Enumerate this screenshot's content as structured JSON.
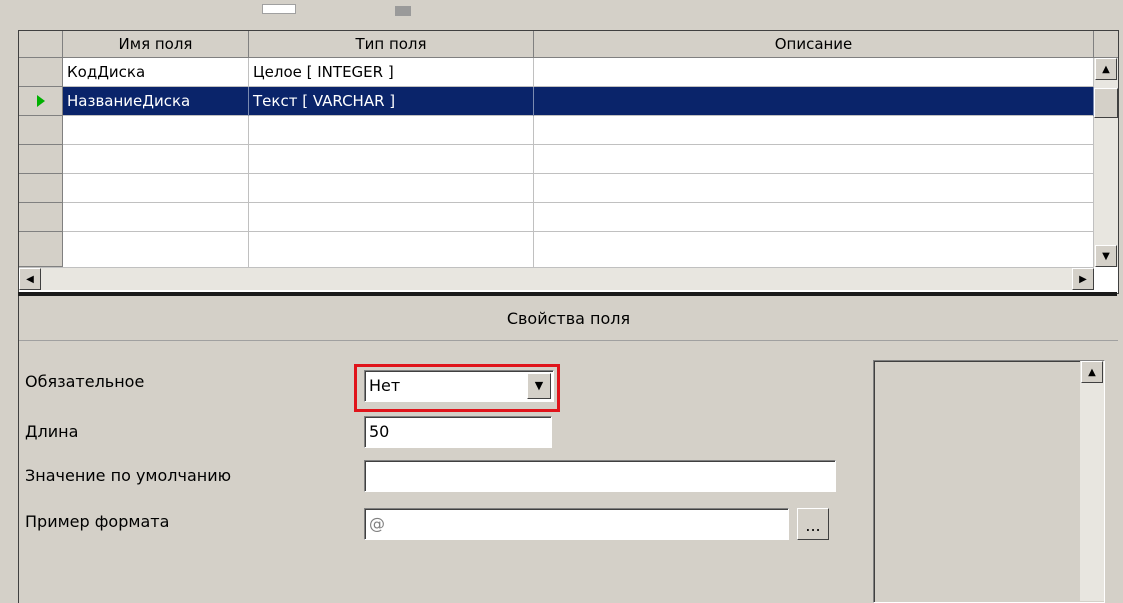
{
  "grid": {
    "columns": [
      "Имя поля",
      "Тип поля",
      "Описание"
    ],
    "rows": [
      {
        "name": "КодДиска",
        "type": "Целое [ INTEGER ]",
        "description": ""
      },
      {
        "name": "НазваниеДиска",
        "type": "Текст [ VARCHAR ]",
        "description": ""
      }
    ],
    "selected_row": 1
  },
  "properties": {
    "title": "Свойства поля",
    "required_label": "Обязательное",
    "required_value": "Нет",
    "length_label": "Длина",
    "length_value": "50",
    "default_label": "Значение по умолчанию",
    "default_value": "",
    "format_label": "Пример формата",
    "format_value": "@",
    "ellipsis_label": "..."
  },
  "icons": {
    "row_pointer": "green-arrow-right-icon",
    "scroll_up": "up-arrow-icon",
    "scroll_down": "down-arrow-icon",
    "scroll_left": "left-arrow-icon",
    "scroll_right": "right-arrow-icon",
    "dropdown": "chevron-down-icon"
  },
  "colors": {
    "selection": "#0a246a",
    "highlight": "#e0141b",
    "window": "#d4d0c8"
  }
}
